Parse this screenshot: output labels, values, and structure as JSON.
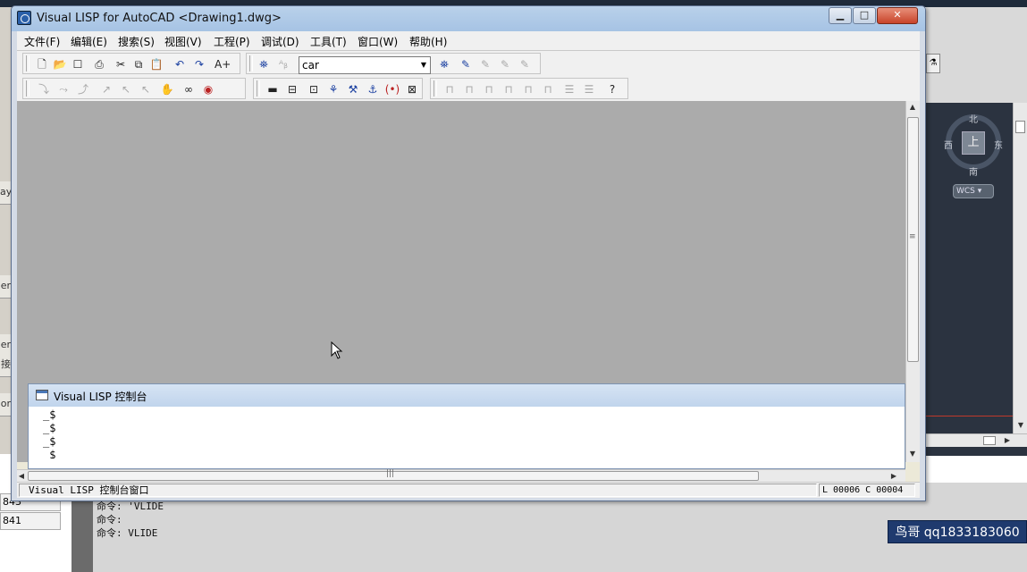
{
  "window": {
    "title": "Visual LISP for AutoCAD <Drawing1.dwg>",
    "minimize_icon": "minimize-icon",
    "maximize_icon": "maximize-icon",
    "close_icon": "close-icon"
  },
  "menu": {
    "items": [
      "文件(F)",
      "编辑(E)",
      "搜索(S)",
      "视图(V)",
      "工程(P)",
      "调试(D)",
      "工具(T)",
      "窗口(W)",
      "帮助(H)"
    ]
  },
  "toolbar": {
    "search_value": "car"
  },
  "console": {
    "title": "Visual LISP 控制台",
    "lines": [
      "_$",
      "_$",
      "_$",
      "_$"
    ]
  },
  "status": {
    "left": "Visual LISP 控制台窗口",
    "right": "L 00006  C 00004"
  },
  "background": {
    "compass": {
      "north": "北",
      "south": "南",
      "east": "东",
      "west": "西",
      "face": "上"
    },
    "wcs_label": "WCS",
    "command_lines": [
      "命令: 'VLIDE",
      "命令:",
      "命令: VLIDE"
    ],
    "coords": [
      "843",
      "841"
    ],
    "left_tabs": [
      "ay",
      "er",
      "er",
      "接",
      "or"
    ]
  },
  "watermark": "鸟哥 qq1833183060",
  "colors": {
    "titlebar": "#b9d1ea",
    "mdi_background": "#ababab",
    "viewport": "#2b3340",
    "watermark_bg": "#1f3a6e"
  }
}
